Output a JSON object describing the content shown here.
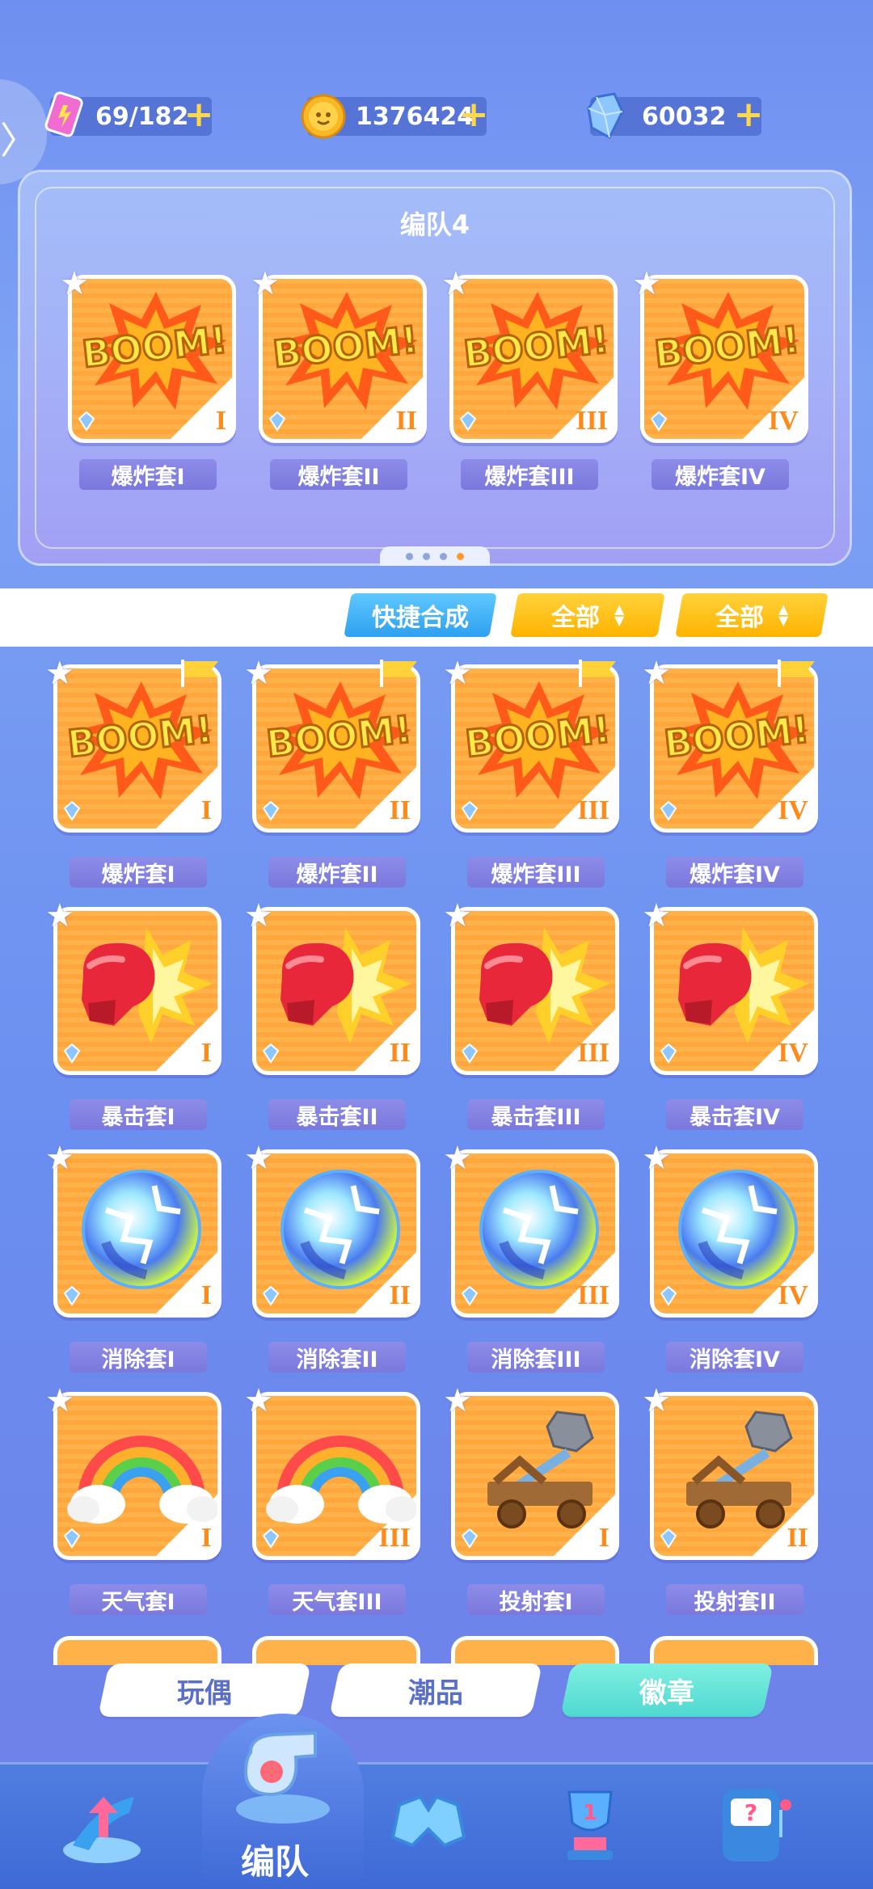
{
  "resources": {
    "stamina": {
      "value": "69/182",
      "icon": "stamina-ticket-icon"
    },
    "coins": {
      "value": "1376424",
      "icon": "coin-icon"
    },
    "gems": {
      "value": "60032",
      "icon": "crystal-gem-icon"
    },
    "plus_label": "+"
  },
  "back_label": "〉",
  "team": {
    "title": "编队4",
    "slots": [
      {
        "label": "爆炸套I",
        "tier": "I",
        "art": "boom"
      },
      {
        "label": "爆炸套II",
        "tier": "II",
        "art": "boom"
      },
      {
        "label": "爆炸套III",
        "tier": "III",
        "art": "boom"
      },
      {
        "label": "爆炸套IV",
        "tier": "IV",
        "art": "boom"
      }
    ],
    "pages": 4,
    "active_page": 4
  },
  "filters": {
    "quick_merge": "快捷合成",
    "filter1": "全部",
    "filter2": "全部"
  },
  "inventory": [
    {
      "label": "爆炸套I",
      "tier": "I",
      "art": "boom",
      "flag": true
    },
    {
      "label": "爆炸套II",
      "tier": "II",
      "art": "boom",
      "flag": true
    },
    {
      "label": "爆炸套III",
      "tier": "III",
      "art": "boom",
      "flag": true
    },
    {
      "label": "爆炸套IV",
      "tier": "IV",
      "art": "boom",
      "flag": true
    },
    {
      "label": "暴击套I",
      "tier": "I",
      "art": "glove",
      "flag": false
    },
    {
      "label": "暴击套II",
      "tier": "II",
      "art": "glove",
      "flag": false
    },
    {
      "label": "暴击套III",
      "tier": "III",
      "art": "glove",
      "flag": false
    },
    {
      "label": "暴击套IV",
      "tier": "IV",
      "art": "glove",
      "flag": false
    },
    {
      "label": "消除套I",
      "tier": "I",
      "art": "orb",
      "flag": false
    },
    {
      "label": "消除套II",
      "tier": "II",
      "art": "orb",
      "flag": false
    },
    {
      "label": "消除套III",
      "tier": "III",
      "art": "orb",
      "flag": false
    },
    {
      "label": "消除套IV",
      "tier": "IV",
      "art": "orb",
      "flag": false
    },
    {
      "label": "天气套I",
      "tier": "I",
      "art": "rainbow",
      "flag": false
    },
    {
      "label": "天气套III",
      "tier": "III",
      "art": "rainbow",
      "flag": false
    },
    {
      "label": "投射套I",
      "tier": "I",
      "art": "catapult",
      "flag": false
    },
    {
      "label": "投射套II",
      "tier": "II",
      "art": "catapult",
      "flag": false
    }
  ],
  "sub_tabs": [
    "玩偶",
    "潮品",
    "徽章"
  ],
  "active_sub_tab": "徽章",
  "bottom_nav": {
    "active_label": "编队",
    "items": [
      "upgrade-arrow-icon",
      "whistle-icon",
      "gamepad-icon",
      "trophy-icon",
      "slot-machine-icon"
    ]
  },
  "colors": {
    "card_orange": "#ffb24a",
    "label_purple": "#8d8ce8",
    "accent_yellow": "#ffd23a",
    "accent_blue": "#2fa0f0",
    "active_tab": "#4fd8d0"
  }
}
